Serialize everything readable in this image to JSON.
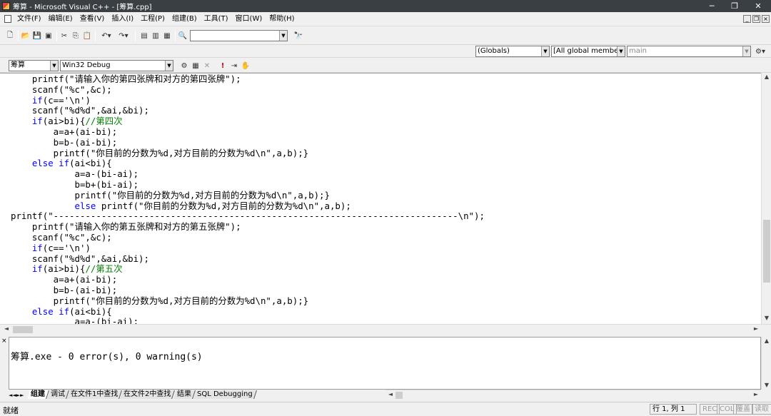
{
  "window": {
    "title": "筹算 - Microsoft Visual C++ - [筹算.cpp]",
    "controls": [
      "─",
      "❐",
      "✕"
    ],
    "mdi_controls": [
      "_",
      "❐",
      "×"
    ]
  },
  "menu": [
    "文件(F)",
    "编辑(E)",
    "查看(V)",
    "插入(I)",
    "工程(P)",
    "组建(B)",
    "工具(T)",
    "窗口(W)",
    "帮助(H)"
  ],
  "toolbar": {
    "find_combo_value": ""
  },
  "wizardbar": {
    "class_combo": "(Globals)",
    "members_combo": "[All global members",
    "function_combo": "main"
  },
  "buildbar": {
    "project_combo": "筹算",
    "config_combo": "Win32 Debug"
  },
  "code_lines": [
    [
      [
        "",
        "    printf(\"请输入你的第四张牌和对方的第四张牌\");"
      ]
    ],
    [
      [
        "",
        "    scanf(\"%c\",&c);"
      ]
    ],
    [
      [
        "",
        "    "
      ],
      [
        "kw",
        "if"
      ],
      [
        "",
        "(c=='\\n')"
      ]
    ],
    [
      [
        "",
        "    scanf(\"%d%d\",&ai,&bi);"
      ]
    ],
    [
      [
        "",
        "    "
      ],
      [
        "kw",
        "if"
      ],
      [
        "",
        "(ai>bi){"
      ],
      [
        "cm",
        "//第四次"
      ]
    ],
    [
      [
        "",
        "        a=a+(ai-bi);"
      ]
    ],
    [
      [
        "",
        "        b=b-(ai-bi);"
      ]
    ],
    [
      [
        "",
        "        printf(\"你目前的分数为%d,对方目前的分数为%d\\n\",a,b);}"
      ]
    ],
    [
      [
        "",
        "    "
      ],
      [
        "kw",
        "else if"
      ],
      [
        "",
        "(ai<bi){"
      ]
    ],
    [
      [
        "",
        "            a=a-(bi-ai);"
      ]
    ],
    [
      [
        "",
        "            b=b+(bi-ai);"
      ]
    ],
    [
      [
        "",
        "            printf(\"你目前的分数为%d,对方目前的分数为%d\\n\",a,b);}"
      ]
    ],
    [
      [
        "",
        "            "
      ],
      [
        "kw",
        "else"
      ],
      [
        "",
        " printf(\"你目前的分数为%d,对方目前的分数为%d\\n\",a,b);"
      ]
    ],
    [
      [
        "",
        "printf(\"----------------------------------------------------------------------------\\n\");"
      ]
    ],
    [
      [
        "",
        "    printf(\"请输入你的第五张牌和对方的第五张牌\");"
      ]
    ],
    [
      [
        "",
        "    scanf(\"%c\",&c);"
      ]
    ],
    [
      [
        "",
        "    "
      ],
      [
        "kw",
        "if"
      ],
      [
        "",
        "(c=='\\n')"
      ]
    ],
    [
      [
        "",
        "    scanf(\"%d%d\",&ai,&bi);"
      ]
    ],
    [
      [
        "",
        "    "
      ],
      [
        "kw",
        "if"
      ],
      [
        "",
        "(ai>bi){"
      ],
      [
        "cm",
        "//第五次"
      ]
    ],
    [
      [
        "",
        "        a=a+(ai-bi);"
      ]
    ],
    [
      [
        "",
        "        b=b-(ai-bi);"
      ]
    ],
    [
      [
        "",
        "        printf(\"你目前的分数为%d,对方目前的分数为%d\\n\",a,b);}"
      ]
    ],
    [
      [
        "",
        "    "
      ],
      [
        "kw",
        "else if"
      ],
      [
        "",
        "(ai<bi){"
      ]
    ],
    [
      [
        "",
        "            a=a-(bi-ai);"
      ]
    ]
  ],
  "output": {
    "text": "筹算.exe - 0 error(s), 0 warning(s)",
    "tabs": [
      {
        "label": "组建",
        "active": true
      },
      {
        "label": "调试",
        "active": false
      },
      {
        "label": "在文件1中查找",
        "active": false
      },
      {
        "label": "在文件2中查找",
        "active": false
      },
      {
        "label": "结果",
        "active": false
      },
      {
        "label": "SQL Debugging",
        "active": false
      }
    ]
  },
  "status": {
    "ready": "就绪",
    "position": "行 1, 列 1",
    "indicators": [
      "REC",
      "COL",
      "覆盖",
      "读取"
    ]
  },
  "colors": {
    "keyword": "#0000ff",
    "comment": "#008000",
    "titlebar": "#3a3f44"
  }
}
